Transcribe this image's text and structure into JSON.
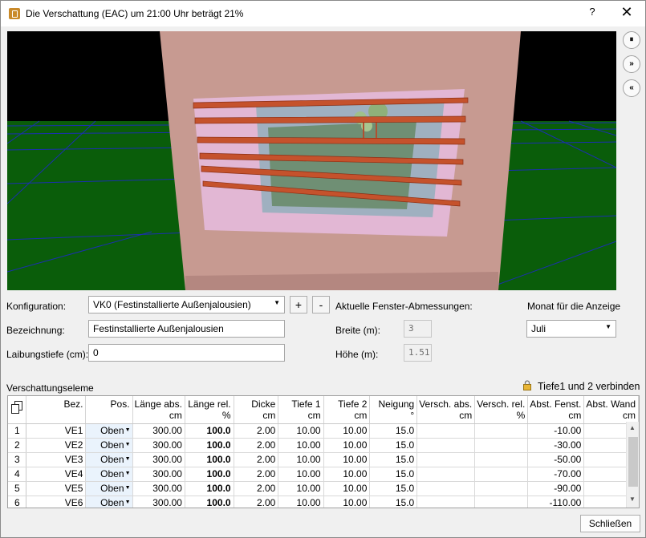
{
  "window": {
    "title": "Die Verschattung (EAC) um 21:00 Uhr beträgt  21%",
    "help_label": "?",
    "close_glyph": "✕"
  },
  "side_buttons": [
    {
      "name": "pause",
      "glyph": "⏸"
    },
    {
      "name": "forward",
      "glyph": "»"
    },
    {
      "name": "back",
      "glyph": "«"
    }
  ],
  "form": {
    "konfiguration_label": "Konfiguration:",
    "konfiguration_value": "VK0 (Festinstallierte Außenjalousien)",
    "add_label": "+",
    "remove_label": "-",
    "bezeichnung_label": "Bezeichnung:",
    "bezeichnung_value": "Festinstallierte Außenjalousien",
    "laibungstiefe_label": "Laibungstiefe (cm):",
    "laibungstiefe_value": "0",
    "fenster_heading": "Aktuelle Fenster-Abmessungen:",
    "breite_label": "Breite (m):",
    "breite_value": "3",
    "hoehe_label": "Höhe (m):",
    "hoehe_value": "1.51",
    "monat_label": "Monat für die Anzeige",
    "monat_value": "Juli"
  },
  "section": {
    "title": "Verschattungseleme",
    "link_label": "Tiefe1 und 2 verbinden"
  },
  "table": {
    "columns": [
      {
        "name": "",
        "unit": ""
      },
      {
        "name": "Bez.",
        "unit": ""
      },
      {
        "name": "Pos.",
        "unit": ""
      },
      {
        "name": "Länge abs.",
        "unit": "cm"
      },
      {
        "name": "Länge rel.",
        "unit": "%"
      },
      {
        "name": "Dicke",
        "unit": "cm"
      },
      {
        "name": "Tiefe 1",
        "unit": "cm"
      },
      {
        "name": "Tiefe 2",
        "unit": "cm"
      },
      {
        "name": "Neigung",
        "unit": "°"
      },
      {
        "name": "Versch. abs.",
        "unit": "cm"
      },
      {
        "name": "Versch. rel.",
        "unit": "%"
      },
      {
        "name": "Abst. Fenst.",
        "unit": "cm"
      },
      {
        "name": "Abst. Wand",
        "unit": "cm"
      }
    ],
    "rows": [
      {
        "n": "1",
        "bez": "VE1",
        "pos": "Oben",
        "laenge_abs": "300.00",
        "laenge_rel": "100.0",
        "dicke": "2.00",
        "tiefe1": "10.00",
        "tiefe2": "10.00",
        "neigung": "15.0",
        "versch_abs": "",
        "versch_rel": "",
        "abst_fenst": "-10.00",
        "abst_wand": ""
      },
      {
        "n": "2",
        "bez": "VE2",
        "pos": "Oben",
        "laenge_abs": "300.00",
        "laenge_rel": "100.0",
        "dicke": "2.00",
        "tiefe1": "10.00",
        "tiefe2": "10.00",
        "neigung": "15.0",
        "versch_abs": "",
        "versch_rel": "",
        "abst_fenst": "-30.00",
        "abst_wand": ""
      },
      {
        "n": "3",
        "bez": "VE3",
        "pos": "Oben",
        "laenge_abs": "300.00",
        "laenge_rel": "100.0",
        "dicke": "2.00",
        "tiefe1": "10.00",
        "tiefe2": "10.00",
        "neigung": "15.0",
        "versch_abs": "",
        "versch_rel": "",
        "abst_fenst": "-50.00",
        "abst_wand": ""
      },
      {
        "n": "4",
        "bez": "VE4",
        "pos": "Oben",
        "laenge_abs": "300.00",
        "laenge_rel": "100.0",
        "dicke": "2.00",
        "tiefe1": "10.00",
        "tiefe2": "10.00",
        "neigung": "15.0",
        "versch_abs": "",
        "versch_rel": "",
        "abst_fenst": "-70.00",
        "abst_wand": ""
      },
      {
        "n": "5",
        "bez": "VE5",
        "pos": "Oben",
        "laenge_abs": "300.00",
        "laenge_rel": "100.0",
        "dicke": "2.00",
        "tiefe1": "10.00",
        "tiefe2": "10.00",
        "neigung": "15.0",
        "versch_abs": "",
        "versch_rel": "",
        "abst_fenst": "-90.00",
        "abst_wand": ""
      },
      {
        "n": "6",
        "bez": "VE6",
        "pos": "Oben",
        "laenge_abs": "300.00",
        "laenge_rel": "100.0",
        "dicke": "2.00",
        "tiefe1": "10.00",
        "tiefe2": "10.00",
        "neigung": "15.0",
        "versch_abs": "",
        "versch_rel": "",
        "abst_fenst": "-110.00",
        "abst_wand": ""
      }
    ]
  },
  "footer": {
    "close_label": "Schließen"
  },
  "colors": {
    "sky": "#000000",
    "ground": "#0b5a0b",
    "wall": "#c89a92",
    "frame": "#e3b9d6",
    "slat": "#c4502a",
    "grid_lines": "#1a2ea8"
  }
}
